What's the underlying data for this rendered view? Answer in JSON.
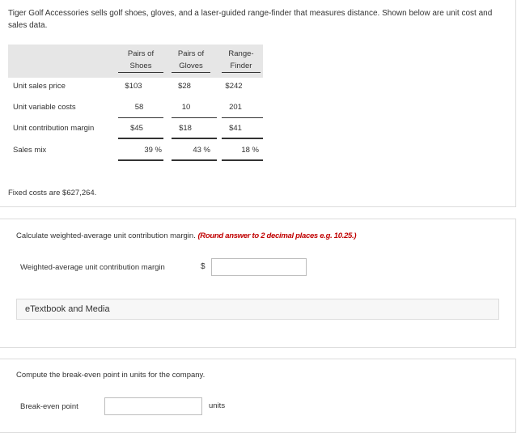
{
  "problem": {
    "intro": "Tiger Golf Accessories sells golf shoes, gloves, and a laser-guided range-finder that measures distance. Shown below are unit cost and sales data.",
    "columns": [
      {
        "line1": "Pairs of",
        "line2": "Shoes"
      },
      {
        "line1": "Pairs of",
        "line2": "Gloves"
      },
      {
        "line1": "Range-",
        "line2": "Finder"
      }
    ],
    "rows": [
      {
        "label": "Unit sales price",
        "values": [
          "$103",
          "$28",
          "$242"
        ]
      },
      {
        "label": "Unit variable costs",
        "values": [
          "58",
          "10",
          "201"
        ]
      },
      {
        "label": "Unit contribution margin",
        "values": [
          "$45",
          "$18",
          "$41"
        ]
      },
      {
        "label": "Sales mix",
        "values": [
          "39 %",
          "43 %",
          "18 %"
        ]
      }
    ],
    "fixed_costs": "Fixed costs are $627,264."
  },
  "part1": {
    "question_text": "Calculate weighted-average unit contribution margin.",
    "instruction": "(Round answer to 2 decimal places e.g. 10.25.)",
    "field_label": "Weighted-average unit contribution margin",
    "currency": "$",
    "value": "",
    "etextbook": "eTextbook and Media"
  },
  "part2": {
    "question_text": "Compute the break-even point in units for the company.",
    "field_label": "Break-even point",
    "value": "",
    "unit": "units"
  }
}
